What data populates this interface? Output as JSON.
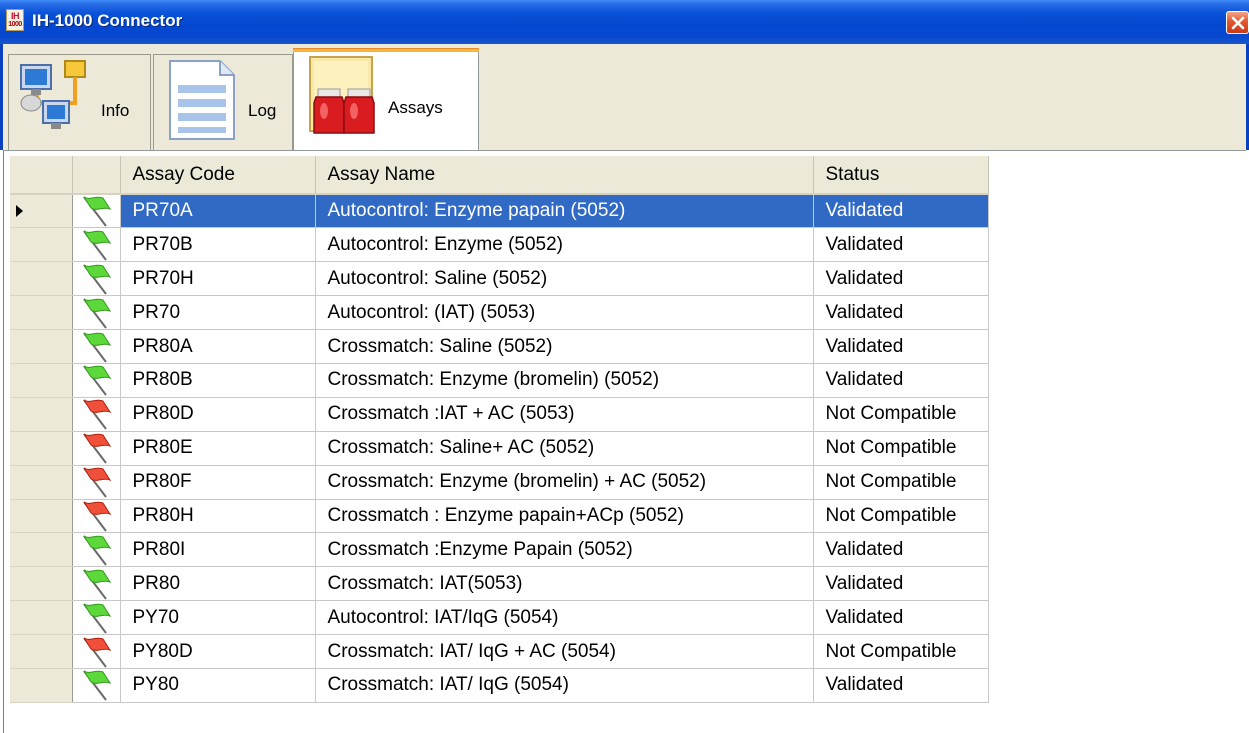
{
  "window": {
    "title": "IH-1000 Connector",
    "app_icon_text": [
      "IH",
      "1000"
    ]
  },
  "tabs": [
    {
      "label": "Info",
      "icon": "network-computers-icon",
      "active": false
    },
    {
      "label": "Log",
      "icon": "document-log-icon",
      "active": false
    },
    {
      "label": "Assays",
      "icon": "reagent-bottles-icon",
      "active": true
    }
  ],
  "grid": {
    "columns": [
      "",
      "",
      "Assay Code",
      "Assay Name",
      "Status"
    ],
    "selected_row": 0,
    "colors": {
      "validated_flag": "#5cd83a",
      "not_compatible_flag": "#f0503a",
      "selection": "#316ac5"
    },
    "rows": [
      {
        "flag": "green",
        "code": "PR70A",
        "name": "Autocontrol: Enzyme papain (5052)",
        "status": "Validated"
      },
      {
        "flag": "green",
        "code": "PR70B",
        "name": "Autocontrol: Enzyme (5052)",
        "status": "Validated"
      },
      {
        "flag": "green",
        "code": "PR70H",
        "name": "Autocontrol: Saline (5052)",
        "status": "Validated"
      },
      {
        "flag": "green",
        "code": "PR70",
        "name": "Autocontrol: (IAT) (5053)",
        "status": "Validated"
      },
      {
        "flag": "green",
        "code": "PR80A",
        "name": "Crossmatch: Saline (5052)",
        "status": "Validated"
      },
      {
        "flag": "green",
        "code": "PR80B",
        "name": "Crossmatch: Enzyme (bromelin) (5052)",
        "status": "Validated"
      },
      {
        "flag": "red",
        "code": "PR80D",
        "name": "Crossmatch :IAT + AC (5053)",
        "status": "Not Compatible"
      },
      {
        "flag": "red",
        "code": "PR80E",
        "name": "Crossmatch: Saline+ AC (5052)",
        "status": "Not Compatible"
      },
      {
        "flag": "red",
        "code": "PR80F",
        "name": "Crossmatch: Enzyme (bromelin) + AC (5052)",
        "status": "Not Compatible"
      },
      {
        "flag": "red",
        "code": "PR80H",
        "name": "Crossmatch : Enzyme papain+ACp (5052)",
        "status": "Not Compatible"
      },
      {
        "flag": "green",
        "code": "PR80I",
        "name": "Crossmatch :Enzyme Papain (5052)",
        "status": "Validated"
      },
      {
        "flag": "green",
        "code": "PR80",
        "name": "Crossmatch: IAT(5053)",
        "status": "Validated"
      },
      {
        "flag": "green",
        "code": "PY70",
        "name": "Autocontrol: IAT/IqG (5054)",
        "status": "Validated"
      },
      {
        "flag": "red",
        "code": "PY80D",
        "name": "Crossmatch: IAT/ IqG + AC (5054)",
        "status": "Not Compatible"
      },
      {
        "flag": "green",
        "code": "PY80",
        "name": "Crossmatch: IAT/ IqG (5054)",
        "status": "Validated"
      }
    ]
  }
}
